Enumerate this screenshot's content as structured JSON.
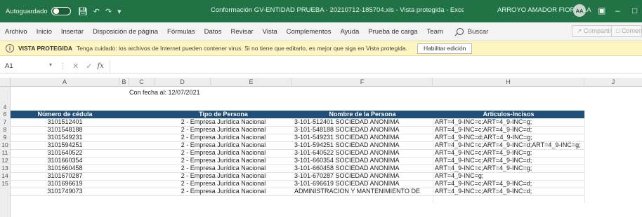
{
  "titlebar": {
    "autosave_label": "Autoguardado",
    "document_title": "Conformación GV-ENTIDAD PRUEBA - 20210712-185704.xls - Vista protegida - Excel",
    "user_name": "ARROYO AMADOR FIORELLA",
    "avatar_initials": "AA",
    "accent": "#217346"
  },
  "menubar": {
    "items": [
      "Archivo",
      "Inicio",
      "Insertar",
      "Disposición de página",
      "Fórmulas",
      "Datos",
      "Revisar",
      "Vista",
      "Complementos",
      "Ayuda",
      "Prueba de carga",
      "Team"
    ],
    "search_label": "Buscar",
    "share_label": "Compartir",
    "comments_label": "Coment"
  },
  "protected_view": {
    "title": "VISTA PROTEGIDA",
    "message": "Tenga cuidado: los archivos de Internet pueden contener virus. Si no tiene que editarlo, es mejor que siga en Vista protegida.",
    "enable_button": "Habilitar edición",
    "bar_color": "#fdf6c3"
  },
  "formula_bar": {
    "name_box": "A1",
    "fx": "fx",
    "value": ""
  },
  "sheet": {
    "columns": [
      "A",
      "B",
      "C",
      "D",
      "E",
      "F",
      "H",
      "J"
    ],
    "date_note": "Con fecha al: 12/07/2021",
    "header_color": "#1f4e79",
    "headers": [
      "Número de cédula",
      "Tipo de Persona",
      "Nombre de la Persona",
      "Articulos-Incisos"
    ],
    "row_numbers": [
      "4",
      "6",
      "7",
      "8",
      "9",
      "10",
      "11",
      "12",
      "13",
      "14",
      "15"
    ],
    "rows": [
      {
        "cedula": "3101512401",
        "tipo": "2 - Empresa Jurídica Nacional",
        "nombre": "3-101-512401 SOCIEDAD ANONIMA",
        "articulos": "ART=4_9-INC=c;ART=4_9-INC=g;"
      },
      {
        "cedula": "3101548188",
        "tipo": "2 - Empresa Jurídica Nacional",
        "nombre": "3-101-548188 SOCIEDAD ANONIMA",
        "articulos": "ART=4_9-INC=c;ART=4_9-INC=d;"
      },
      {
        "cedula": "3101549231",
        "tipo": "2 - Empresa Jurídica Nacional",
        "nombre": "3-101-549231 SOCIEDAD ANONIMA",
        "articulos": "ART=4_9-INC=d;ART=4_9-INC=g;"
      },
      {
        "cedula": "3101594251",
        "tipo": "2 - Empresa Jurídica Nacional",
        "nombre": "3-101-594251 SOCIEDAD ANONIMA",
        "articulos": "ART=4_9-INC=c;ART=4_9-INC=d;ART=4_9-INC=g;"
      },
      {
        "cedula": "3101640522",
        "tipo": "2 - Empresa Jurídica Nacional",
        "nombre": "3-101-640522 SOCIEDAD ANONIMA",
        "articulos": "ART=4_9-INC=c;ART=4_9-INC=g;"
      },
      {
        "cedula": "3101660354",
        "tipo": "2 - Empresa Jurídica Nacional",
        "nombre": "3-101-660354 SOCIEDAD ANONIMA",
        "articulos": "ART=4_9-INC=c;ART=4_9-INC=d;"
      },
      {
        "cedula": "3101660458",
        "tipo": "2 - Empresa Jurídica Nacional",
        "nombre": "3-101-660458 SOCIEDAD ANONIMA",
        "articulos": "ART=4_9-INC=c;ART=4_9-INC=g;"
      },
      {
        "cedula": "3101670287",
        "tipo": "2 - Empresa Jurídica Nacional",
        "nombre": "3-101-670287 SOCIEDAD ANONIMA",
        "articulos": "ART=4_9-INC=g;"
      },
      {
        "cedula": "3101696619",
        "tipo": "2 - Empresa Jurídica Nacional",
        "nombre": "3-101-696619 SOCIEDAD ANONIMA",
        "articulos": "ART=4_9-INC=c;ART=4_9-INC=d;"
      },
      {
        "cedula": "3101749073",
        "tipo": "2 - Empresa Jurídica Nacional",
        "nombre": "ADMINISTRACION Y MANTENIMIENTO DE",
        "articulos": "ART=4_9-INC=c;ART=4_9-INC=d;"
      }
    ]
  }
}
